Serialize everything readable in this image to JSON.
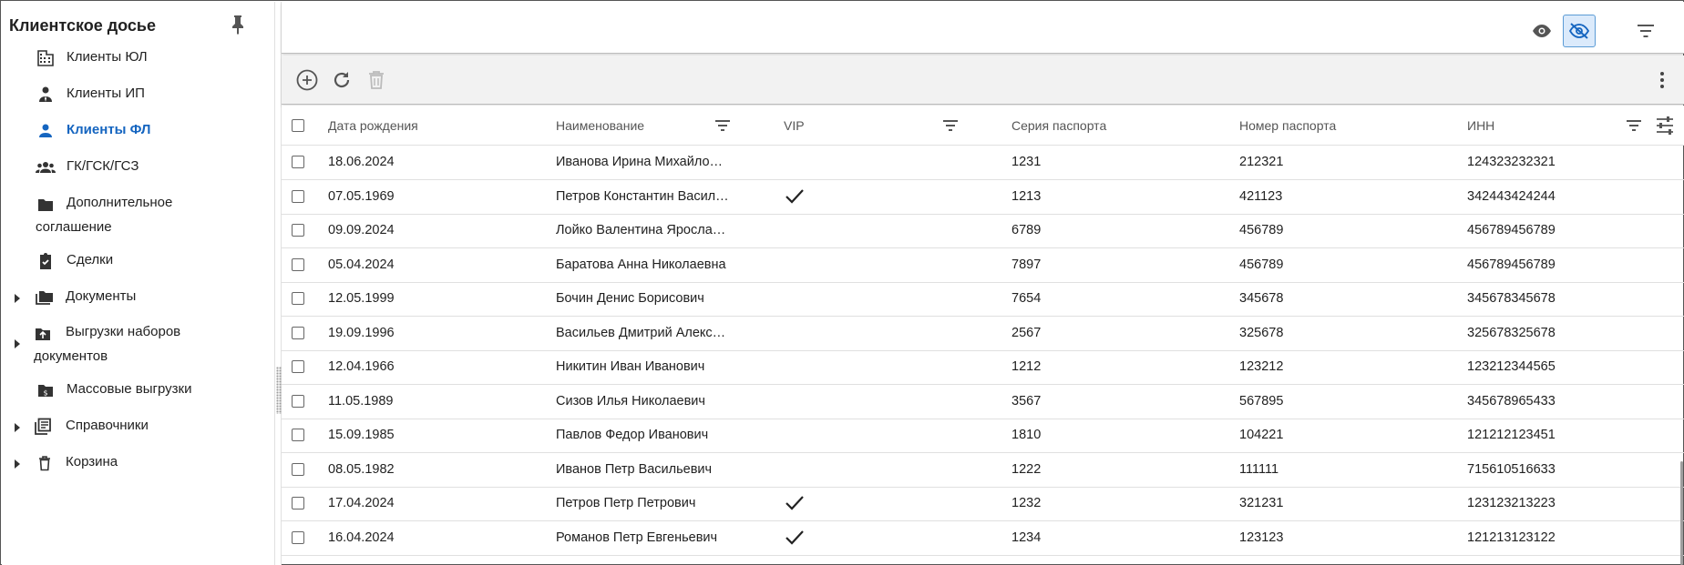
{
  "sidebar": {
    "title": "Клиентское досье",
    "items": [
      {
        "label": "Клиенты ЮЛ",
        "icon": "building-icon"
      },
      {
        "label": "Клиенты ИП",
        "icon": "person-tie-icon"
      },
      {
        "label": "Клиенты ФЛ",
        "icon": "person-icon",
        "active": true
      },
      {
        "label": "ГК/ГСК/ГСЗ",
        "icon": "group-icon"
      },
      {
        "label_line1": "Дополнительное",
        "label_line2": "соглашение",
        "icon": "folder-icon"
      },
      {
        "label": "Сделки",
        "icon": "clipboard-check-icon"
      },
      {
        "label": "Документы",
        "icon": "folders-icon",
        "expandable": true
      },
      {
        "label_line1": "Выгрузки наборов",
        "label_line2": "документов",
        "icon": "folder-upload-icon",
        "expandable": true
      },
      {
        "label": "Массовые выгрузки",
        "icon": "folder-dollar-icon"
      },
      {
        "label": "Справочники",
        "icon": "library-icon",
        "expandable": true
      },
      {
        "label": "Корзина",
        "icon": "trash-icon",
        "expandable": true
      }
    ]
  },
  "colors": {
    "accent": "#1565c0",
    "eye_off_bg": "#dbeafb",
    "eye_off_border": "#5b9bd5"
  },
  "table": {
    "columns": [
      "Дата рождения",
      "Наименование",
      "VIP",
      "Серия паспорта",
      "Номер паспорта",
      "ИНН"
    ],
    "rows": [
      {
        "dob": "18.06.2024",
        "name": "Иванова Ирина Михайловна",
        "vip": false,
        "series": "1231",
        "number": "212321",
        "inn": "124323232321"
      },
      {
        "dob": "07.05.1969",
        "name": "Петров Константин Васильевич",
        "vip": true,
        "series": "1213",
        "number": "421123",
        "inn": "342443424244"
      },
      {
        "dob": "09.09.2024",
        "name": "Лойко Валентина Ярославовна",
        "vip": false,
        "series": "6789",
        "number": "456789",
        "inn": "456789456789"
      },
      {
        "dob": "05.04.2024",
        "name": "Баратова Анна Николаевна",
        "vip": false,
        "series": "7897",
        "number": "456789",
        "inn": "456789456789"
      },
      {
        "dob": "12.05.1999",
        "name": "Бочин Денис Борисович",
        "vip": false,
        "series": "7654",
        "number": "345678",
        "inn": "345678345678"
      },
      {
        "dob": "19.09.1996",
        "name": "Васильев Дмитрий Алексеевич",
        "vip": false,
        "series": "2567",
        "number": "325678",
        "inn": "325678325678"
      },
      {
        "dob": "12.04.1966",
        "name": "Никитин Иван Иванович",
        "vip": false,
        "series": "1212",
        "number": "123212",
        "inn": "123212344565"
      },
      {
        "dob": "11.05.1989",
        "name": "Сизов Илья Николаевич",
        "vip": false,
        "series": "3567",
        "number": "567895",
        "inn": "345678965433"
      },
      {
        "dob": "15.09.1985",
        "name": "Павлов Федор Иванович",
        "vip": false,
        "series": "1810",
        "number": "104221",
        "inn": "121212123451"
      },
      {
        "dob": "08.05.1982",
        "name": "Иванов Петр Васильевич",
        "vip": false,
        "series": "1222",
        "number": "111111",
        "inn": "715610516633"
      },
      {
        "dob": "17.04.2024",
        "name": "Петров Петр Петрович",
        "vip": true,
        "series": "1232",
        "number": "321231",
        "inn": "123123213223"
      },
      {
        "dob": "16.04.2024",
        "name": "Романов Петр Евгеньевич",
        "vip": true,
        "series": "1234",
        "number": "123123",
        "inn": "121213123122"
      }
    ]
  }
}
